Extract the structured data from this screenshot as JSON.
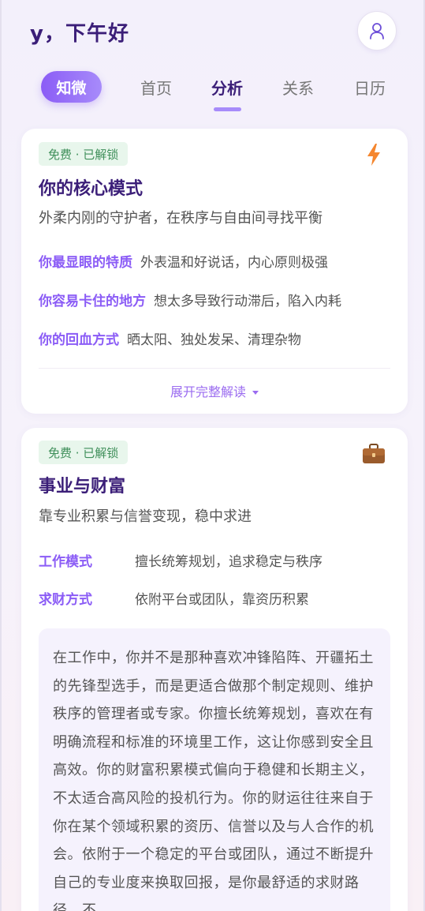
{
  "header": {
    "greeting": "y，下午好",
    "profile_icon": "user-icon"
  },
  "tabs": {
    "brand": "知微",
    "items": [
      {
        "label": "首页",
        "active": false
      },
      {
        "label": "分析",
        "active": true
      },
      {
        "label": "关系",
        "active": false
      },
      {
        "label": "日历",
        "active": false
      }
    ]
  },
  "core_card": {
    "badge": "免费 · 已解锁",
    "icon": "lightning-icon",
    "title": "你的核心模式",
    "subtitle": "外柔内刚的守护者，在秩序与自由间寻找平衡",
    "traits": [
      {
        "label": "你最显眼的特质",
        "value": "外表温和好说话，内心原则极强"
      },
      {
        "label": "你容易卡住的地方",
        "value": "想太多导致行动滞后，陷入内耗"
      },
      {
        "label": "你的回血方式",
        "value": "晒太阳、独处发呆、清理杂物"
      }
    ],
    "expand_label": "展开完整解读"
  },
  "career_card": {
    "badge": "免费 · 已解锁",
    "icon": "briefcase-icon",
    "title": "事业与财富",
    "subtitle": "靠专业积累与信誉变现，稳中求进",
    "rows": [
      {
        "label": "工作模式",
        "value": "擅长统筹规划，追求稳定与秩序"
      },
      {
        "label": "求财方式",
        "value": "依附平台或团队，靠资历积累"
      }
    ],
    "detail": "在工作中，你并不是那种喜欢冲锋陷阵、开疆拓土的先锋型选手，而是更适合做那个制定规则、维护秩序的管理者或专家。你擅长统筹规划，喜欢在有明确流程和标准的环境里工作，这让你感到安全且高效。你的财富积累模式偏向于稳健和长期主义，不太适合高风险的投机行为。你的财运往往来自于你在某个领域积累的资历、信誉以及与人合作的机会。依附于一个稳定的平台或团队，通过不断提升自己的专业度来换取回报，是你最舒适的求财路径。不"
  }
}
